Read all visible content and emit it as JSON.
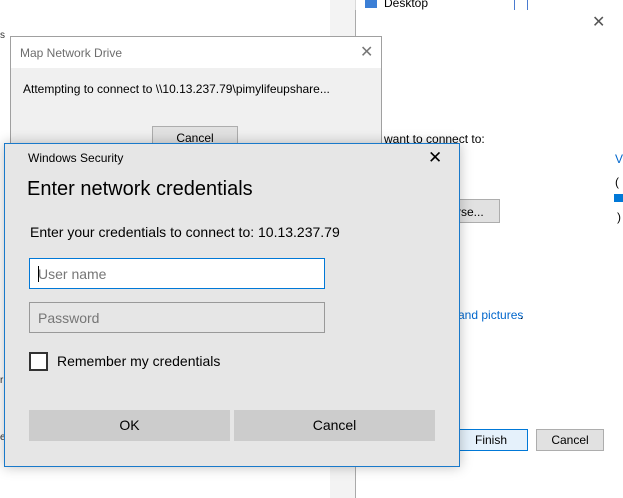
{
  "background": {
    "explorer_item_label": "Desktop",
    "wizard": {
      "prompt_text": "want to connect to:",
      "browse_label": "rse...",
      "link_text": "and pictures",
      "link_suffix": ".",
      "finish_label": "Finish",
      "cancel_label": "Cancel",
      "edge_text_1": "V",
      "edge_text_2": "(",
      "edge_text_3": ")"
    },
    "left_edge": [
      "s",
      "r",
      "e"
    ]
  },
  "map_network_drive": {
    "title": "Map Network Drive",
    "message": "Attempting to connect to \\\\10.13.237.79\\pimylifeupshare...",
    "cancel_label": "Cancel"
  },
  "windows_security": {
    "title": "Windows Security",
    "heading": "Enter network credentials",
    "subtitle": "Enter your credentials to connect to: 10.13.237.79",
    "username": {
      "value": "",
      "placeholder": "User name"
    },
    "password": {
      "value": "",
      "placeholder": "Password"
    },
    "remember_label": "Remember my credentials",
    "remember_checked": false,
    "ok_label": "OK",
    "cancel_label": "Cancel"
  },
  "colors": {
    "accent": "#0078d7",
    "dialog_bg": "#e6e6e6",
    "button_bg": "#cccccc"
  }
}
